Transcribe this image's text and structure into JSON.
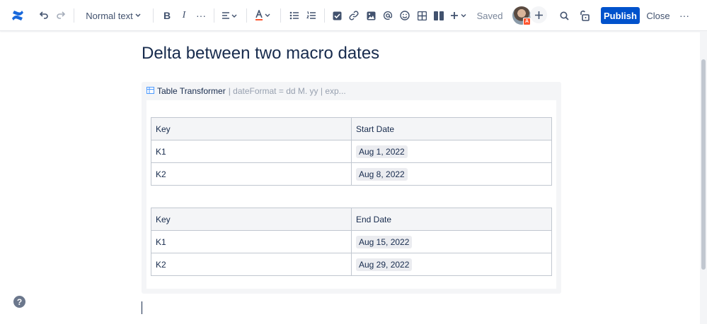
{
  "toolbar": {
    "text_style": "Normal text",
    "saved_label": "Saved",
    "publish_label": "Publish",
    "close_label": "Close",
    "avatar_badge": "A",
    "icons": [
      "confluence-logo-icon",
      "undo-icon",
      "redo-icon",
      "chevron-down-icon",
      "bold-icon",
      "italic-icon",
      "more-formatting-icon",
      "align-icon",
      "text-color-icon",
      "bullet-list-icon",
      "numbered-list-icon",
      "action-item-icon",
      "link-icon",
      "image-icon",
      "mention-icon",
      "emoji-icon",
      "table-icon",
      "layouts-icon",
      "insert-icon",
      "search-icon",
      "restrictions-icon",
      "more-icon",
      "help-icon"
    ]
  },
  "page": {
    "title": "Delta between two macro dates"
  },
  "macro": {
    "name": "Table Transformer",
    "params": "| dateFormat = dd M. yy | exp..."
  },
  "table1": {
    "headers": [
      "Key",
      "Start Date"
    ],
    "rows": [
      {
        "key": "K1",
        "date": "Aug 1, 2022"
      },
      {
        "key": "K2",
        "date": "Aug 8, 2022"
      }
    ]
  },
  "table2": {
    "headers": [
      "Key",
      "End Date"
    ],
    "rows": [
      {
        "key": "K1",
        "date": "Aug 15, 2022"
      },
      {
        "key": "K2",
        "date": "Aug 29, 2022"
      }
    ]
  },
  "colors": {
    "accent": "#0052cc",
    "logo": "#1868db",
    "badge": "#ff5630"
  }
}
